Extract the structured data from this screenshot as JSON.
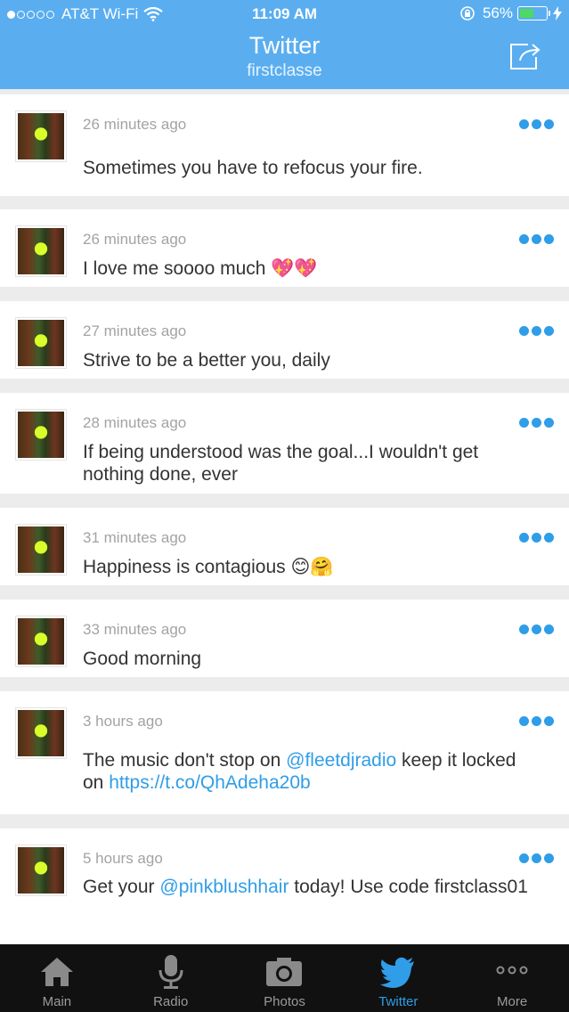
{
  "status": {
    "carrier": "AT&T Wi-Fi",
    "time": "11:09 AM",
    "battery": "56%",
    "battery_level": 0.56,
    "signal_bars": 1
  },
  "nav": {
    "title": "Twitter",
    "subtitle": "firstclasse",
    "share_icon": "share-icon"
  },
  "tweets": [
    {
      "time": "26 minutes ago",
      "text": "Sometimes you have to refocus your fire."
    },
    {
      "time": "26 minutes ago",
      "text": "I love me soooo much",
      "emoji": "💖💖"
    },
    {
      "time": "27 minutes ago",
      "text": "Strive to be a better you, daily"
    },
    {
      "time": "28 minutes ago",
      "text": "If being understood was the goal...I wouldn't get nothing done, ever"
    },
    {
      "time": "31 minutes ago",
      "text": "Happiness is contagious",
      "emoji": "😊🤗"
    },
    {
      "time": "33 minutes ago",
      "text": "Good morning"
    },
    {
      "time": "3 hours ago",
      "text_before": "The music don't stop on ",
      "mention": "@fleetdjradio",
      "text_middle": " keep it locked on ",
      "link": "https://t.co/QhAdeha20b"
    },
    {
      "time": "5 hours ago",
      "text_before": "Get your ",
      "mention": "@pinkblushhair",
      "text_after": " today! Use code firstclass01"
    }
  ],
  "tabs": [
    {
      "label": "Main",
      "icon": "home-icon"
    },
    {
      "label": "Radio",
      "icon": "microphone-icon"
    },
    {
      "label": "Photos",
      "icon": "camera-icon"
    },
    {
      "label": "Twitter",
      "icon": "twitter-bird-icon",
      "active": true
    },
    {
      "label": "More",
      "icon": "more-icon"
    }
  ],
  "colors": {
    "header": "#5aaef0",
    "accent": "#2f9de8",
    "tabbar": "#111111",
    "separator": "#ececec"
  }
}
